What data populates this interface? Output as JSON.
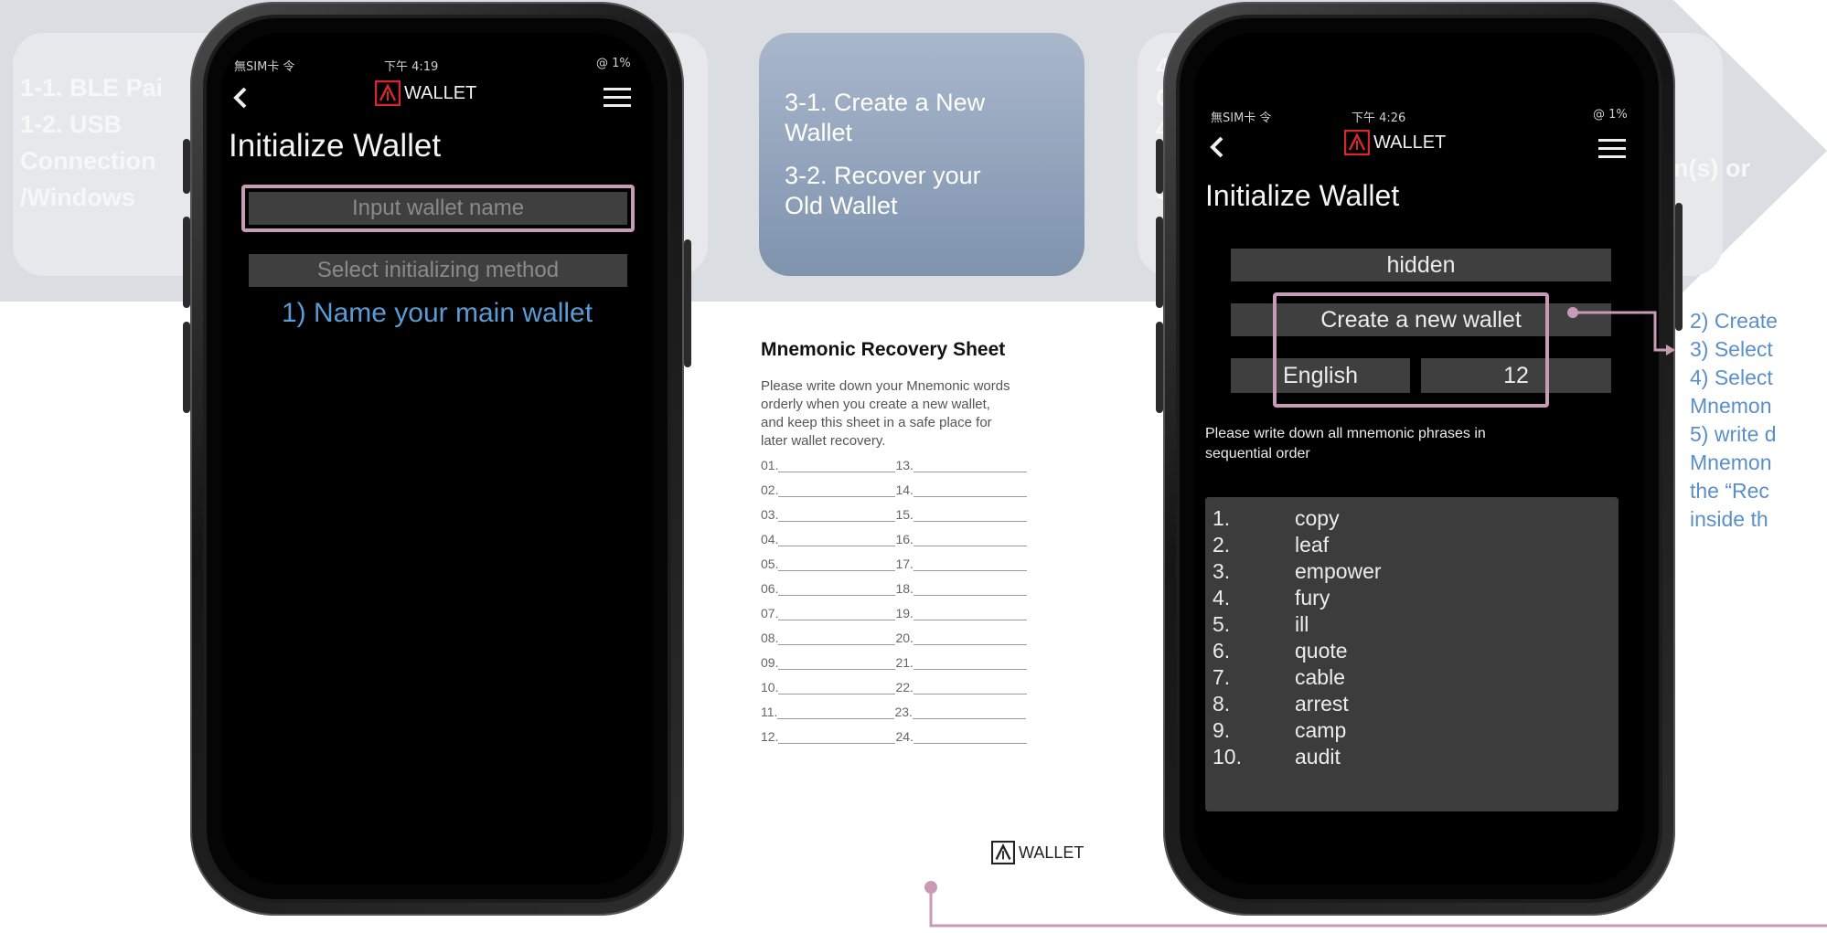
{
  "band": {
    "left_lines": [
      "1-1. BLE Pai",
      "1-2. USB",
      "Connection",
      "/Windows"
    ],
    "right_lines": [
      "4-",
      "Cr",
      "4-",
      "cr",
      "Si"
    ],
    "right_fragment": "ion(s) or"
  },
  "step3": {
    "lines": [
      "3-1. Create a New",
      "Wallet",
      "3-2. Recover your",
      "Old Wallet"
    ]
  },
  "phone_left": {
    "carrier": "無SIM卡 令",
    "time": "下午 4:19",
    "battery": "@ 1%",
    "logo": "WALLET",
    "back_icon": "chevron-left-icon",
    "menu_icon": "hamburger-menu-icon",
    "title": "Initialize Wallet",
    "name_placeholder": "Input wallet name",
    "method_label": "Select initializing method",
    "caption": "1) Name your main wallet"
  },
  "sheet": {
    "title": "Mnemonic Recovery Sheet",
    "body": [
      "Please write down your Mnemonic words",
      "orderly when you create a new wallet,",
      "and keep this sheet in a safe place for",
      "later wallet recovery."
    ],
    "left_numbers": [
      "01.",
      "02.",
      "03.",
      "04.",
      "05.",
      "06.",
      "07.",
      "08.",
      "09.",
      "10.",
      "11.",
      "12."
    ],
    "right_numbers": [
      "13.",
      "14.",
      "15.",
      "16.",
      "17.",
      "18.",
      "19.",
      "20.",
      "21.",
      "22.",
      "23.",
      "24."
    ],
    "logo": "WALLET"
  },
  "phone_right": {
    "carrier": "無SIM卡 令",
    "time": "下午 4:26",
    "battery": "@ 1%",
    "logo": "WALLET",
    "title": "Initialize Wallet",
    "name_value": "hidden",
    "method_value": "Create a new wallet",
    "language": "English",
    "word_count": "12",
    "instruction": [
      "Please write down all mnemonic phrases in",
      "sequential order"
    ],
    "words": [
      {
        "n": "1.",
        "w": "copy"
      },
      {
        "n": "2.",
        "w": "leaf"
      },
      {
        "n": "3.",
        "w": "empower"
      },
      {
        "n": "4.",
        "w": "fury"
      },
      {
        "n": "5.",
        "w": "ill"
      },
      {
        "n": "6.",
        "w": "quote"
      },
      {
        "n": "7.",
        "w": "cable"
      },
      {
        "n": "8.",
        "w": "arrest"
      },
      {
        "n": "9.",
        "w": "camp"
      },
      {
        "n": "10.",
        "w": "audit"
      }
    ]
  },
  "notes": {
    "lines": [
      "2) Create",
      "3) Select",
      "4) Select",
      "Mnemon",
      "5) write d",
      "Mnemon",
      "the “Rec",
      "inside th"
    ]
  },
  "colors": {
    "accent_pink": "#c79bb6",
    "caption_blue": "#5b9bd5",
    "note_blue": "#5b8fc7",
    "logo_red": "#d8262f"
  }
}
